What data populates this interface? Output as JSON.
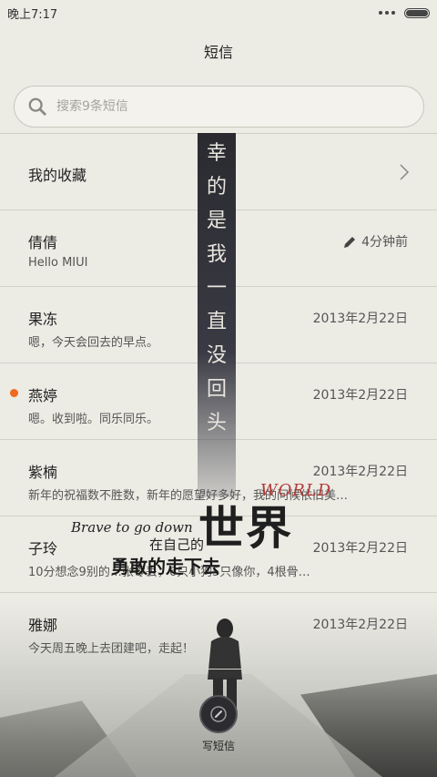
{
  "status_bar": {
    "time": "晚上7:17"
  },
  "header": {
    "title": "短信"
  },
  "search": {
    "placeholder": "搜索9条短信"
  },
  "favorites": {
    "label": "我的收藏"
  },
  "conversations": [
    {
      "name": "倩倩",
      "preview": "Hello MIUI",
      "time": "4分钟前",
      "draft": true,
      "unread": false
    },
    {
      "name": "果冻",
      "preview": "嗯，今天会回去的早点。",
      "time": "2013年2月22日",
      "draft": false,
      "unread": false
    },
    {
      "name": "燕婷",
      "preview": "嗯。收到啦。同乐同乐。",
      "time": "2013年2月22日",
      "draft": false,
      "unread": true
    },
    {
      "name": "紫楠",
      "preview": "新年的祝福数不胜数，新年的愿望好多好，我的问候依旧美…",
      "time": "2013年2月22日",
      "draft": false,
      "unread": false
    },
    {
      "name": "子玲",
      "preview": "10分想念9别的…张零丢，6只小狗5只像你，4根骨…",
      "time": "2013年2月22日",
      "draft": false,
      "unread": false
    },
    {
      "name": "雅娜",
      "preview": "今天周五晚上去团建吧，走起！",
      "time": "2013年2月22日",
      "draft": false,
      "unread": false
    }
  ],
  "wallpaper": {
    "vertical_text": "幸的是我一直没回头",
    "world": "WORLD",
    "brave": "Brave to go down",
    "shijie": "世界",
    "zaiziji": "在自己的",
    "yonggan": "勇敢的走下去"
  },
  "compose": {
    "label": "写短信"
  },
  "colors": {
    "unread_dot": "#f06a1f",
    "background": "#ecebe4"
  }
}
